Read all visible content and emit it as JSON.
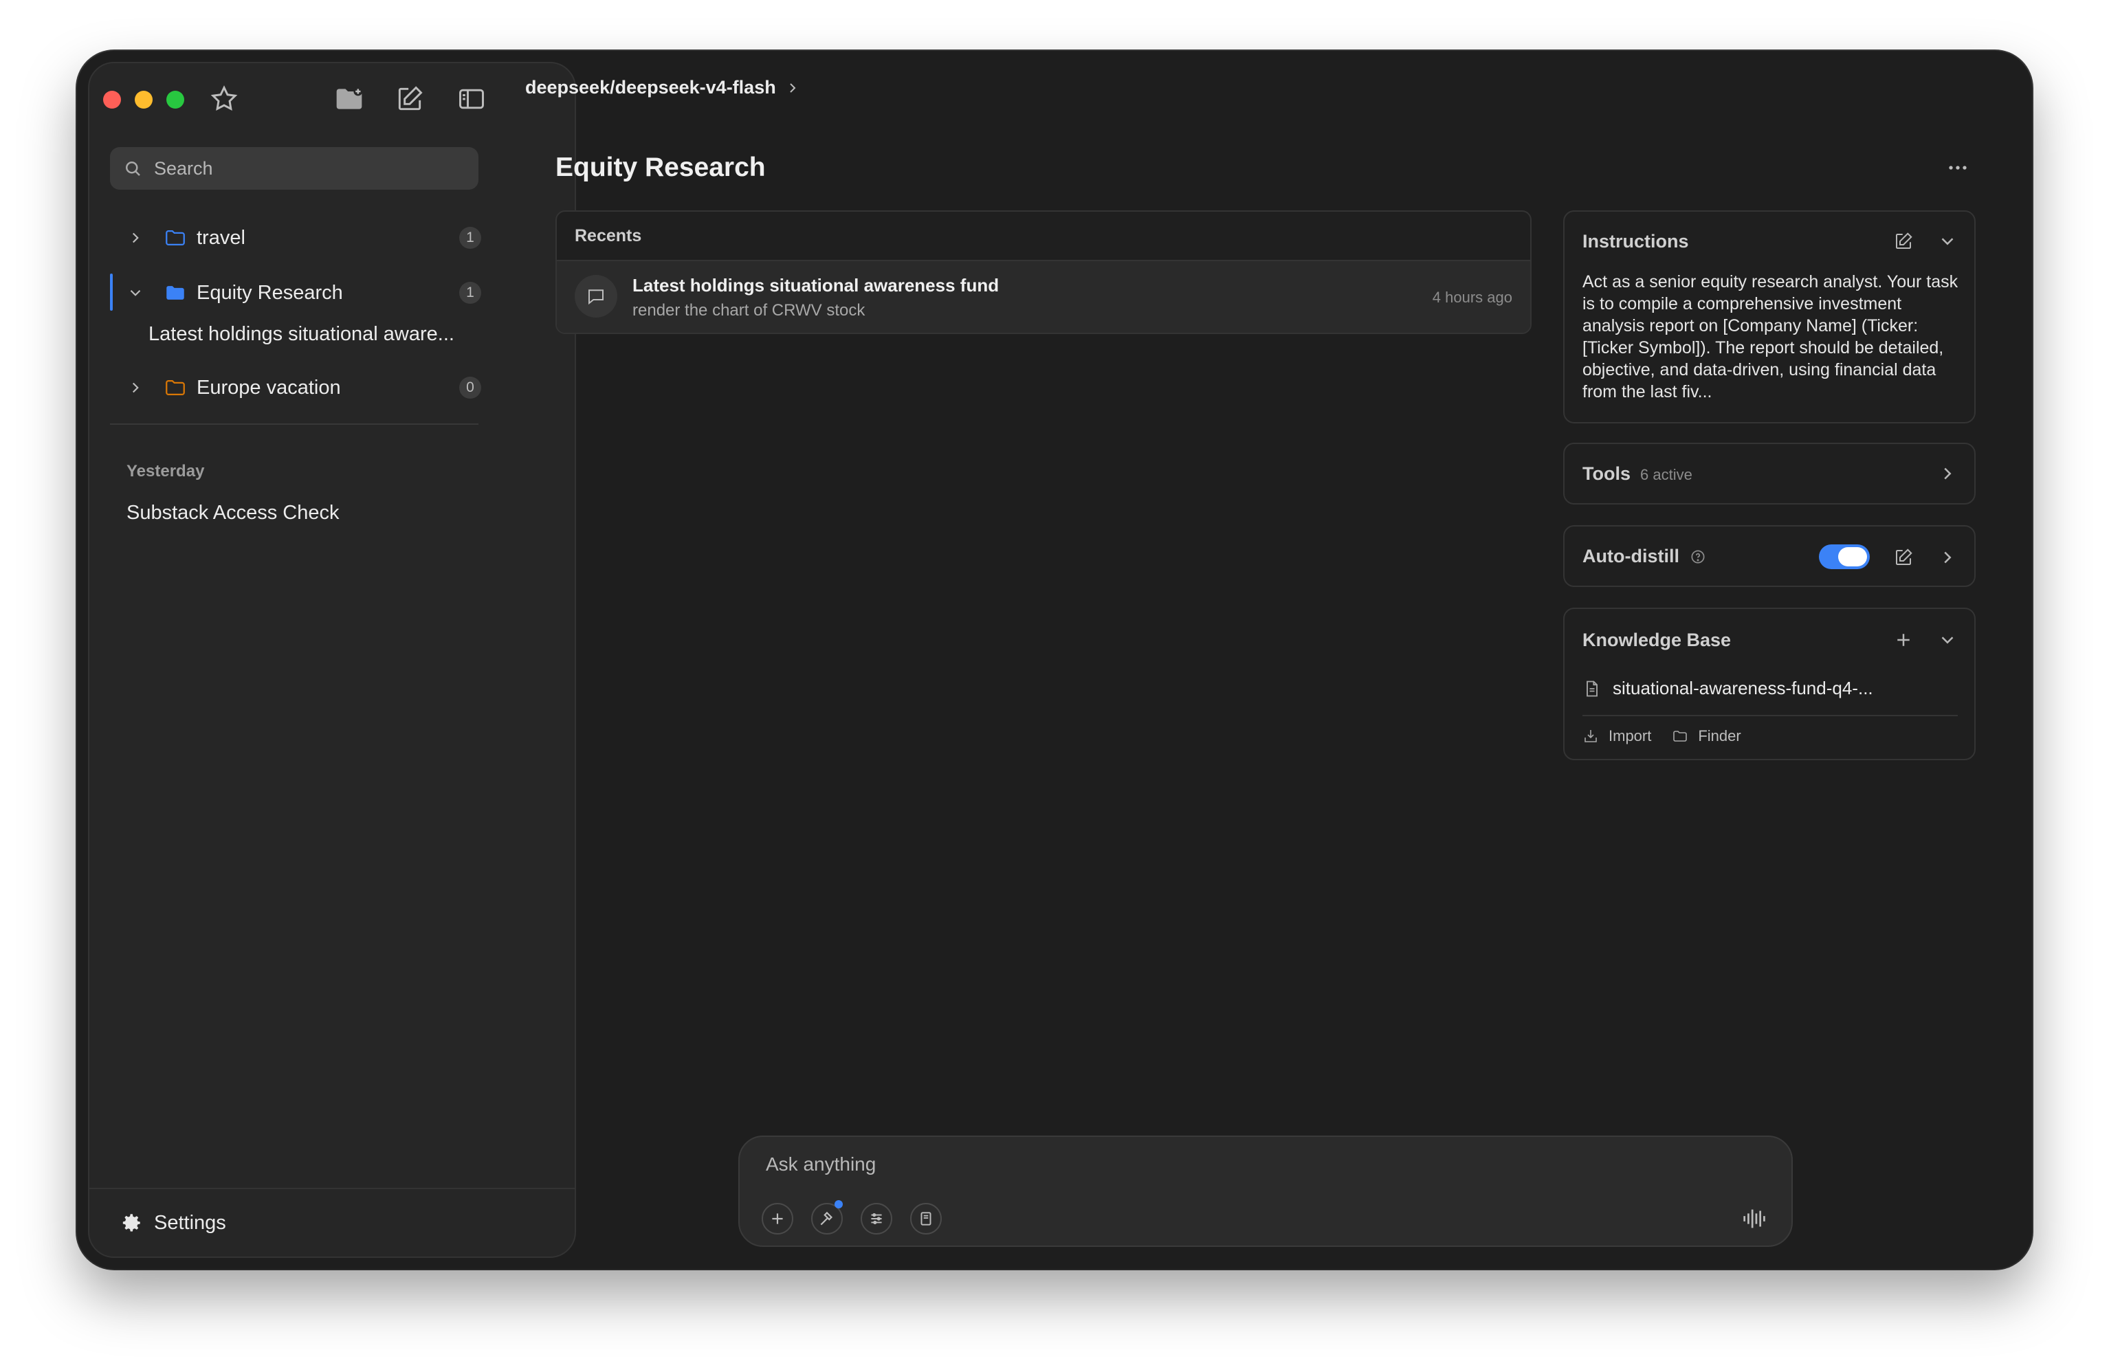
{
  "header": {
    "model_breadcrumb": "deepseek/deepseek-v4-flash",
    "page_title": "Equity Research"
  },
  "sidebar": {
    "search_placeholder": "Search",
    "folders": [
      {
        "label": "travel",
        "count": "1",
        "color": "#3b82f6"
      },
      {
        "label": "Equity Research",
        "count": "1",
        "color": "#3b82f6"
      },
      {
        "label": "Europe vacation",
        "count": "0",
        "color": "#d97706"
      }
    ],
    "equity_children": [
      "Latest holdings situational aware..."
    ],
    "sections": [
      {
        "label": "Yesterday",
        "items": [
          "Substack Access Check"
        ]
      }
    ],
    "settings_label": "Settings"
  },
  "recents": {
    "heading": "Recents",
    "items": [
      {
        "title": "Latest holdings situational awareness fund",
        "subtitle": "render the chart of CRWV stock",
        "time": "4 hours ago"
      }
    ]
  },
  "instructions": {
    "heading": "Instructions",
    "text": "Act as a senior equity research analyst. Your task is to compile a comprehensive investment analysis report on [Company Name] (Ticker: [Ticker Symbol]). The report should be detailed, objective, and data-driven, using financial data from the last fiv..."
  },
  "tools": {
    "heading": "Tools",
    "status": "6 active"
  },
  "auto_distill": {
    "heading": "Auto-distill",
    "enabled": true
  },
  "knowledge_base": {
    "heading": "Knowledge Base",
    "files": [
      "situational-awareness-fund-q4-..."
    ],
    "import_label": "Import",
    "finder_label": "Finder"
  },
  "composer": {
    "placeholder": "Ask anything"
  },
  "colors": {
    "accent": "#3b82f6",
    "background": "#1e1e1e",
    "sidebar": "#262626"
  }
}
